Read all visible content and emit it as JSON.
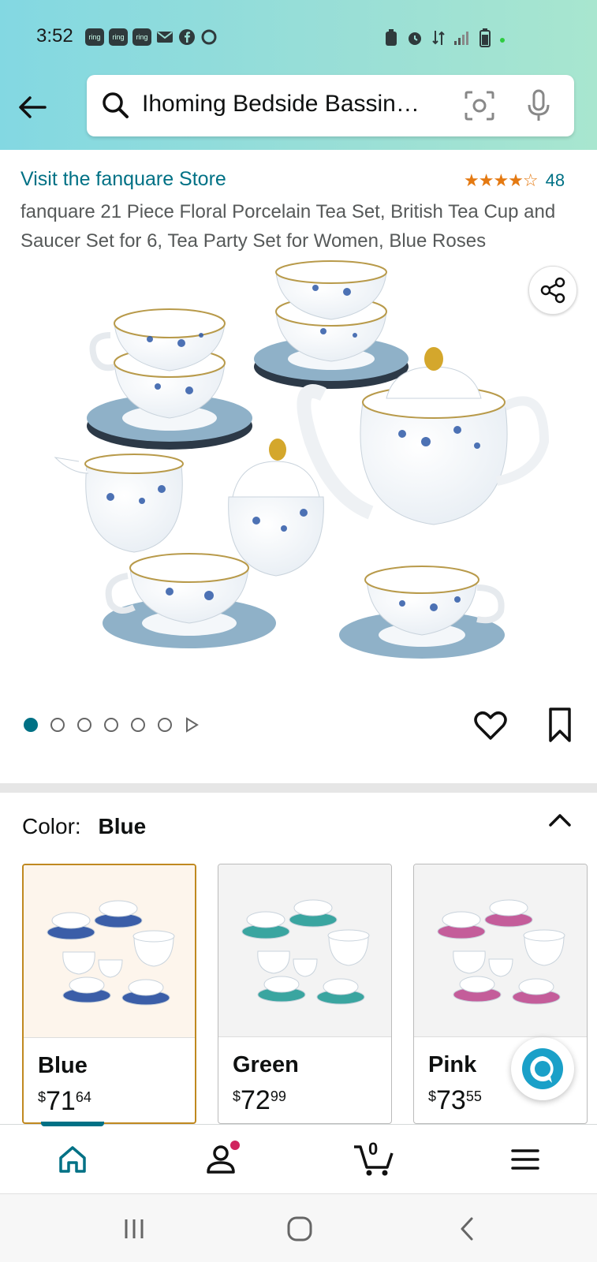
{
  "status_bar": {
    "time": "3:52",
    "notifications": [
      "ring",
      "ring",
      "ring"
    ]
  },
  "search": {
    "query": "Ihoming Bedside Bassin…"
  },
  "product": {
    "store_link": "Visit the fanquare Store",
    "rating_stars": "★★★★☆",
    "rating_value": 4.5,
    "rating_count": "48",
    "title": "fanquare 21 Piece Floral Porcelain Tea Set, British Tea Cup and Saucer Set for 6, Tea Party Set for Women, Blue Roses",
    "image_count": 6,
    "active_image_index": 0
  },
  "color_selector": {
    "label": "Color:",
    "selected": "Blue",
    "options": [
      {
        "name": "Blue",
        "currency": "$",
        "whole": "71",
        "fraction": "64",
        "accent": "#3b5ea8"
      },
      {
        "name": "Green",
        "currency": "$",
        "whole": "72",
        "fraction": "99",
        "accent": "#3aa5a0"
      },
      {
        "name": "Pink",
        "currency": "$",
        "whole": "73",
        "fraction": "55",
        "accent": "#c45d9a"
      }
    ]
  },
  "bottom_nav": {
    "cart_count": "0"
  },
  "colors": {
    "link": "#007185",
    "star": "#e47911",
    "selected_border": "#c08920",
    "header_start": "#83d8e2",
    "header_end": "#a8e6cf"
  }
}
